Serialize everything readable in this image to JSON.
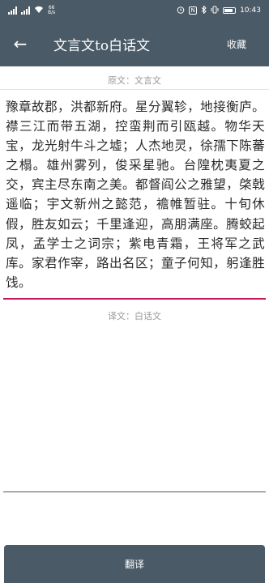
{
  "status_bar": {
    "net_speed_value": "66",
    "net_speed_unit": "B/s",
    "time": "10:43",
    "nfc_label": "N",
    "battery_percent": 70
  },
  "app_bar": {
    "title": "文言文to白话文",
    "back_glyph": "←",
    "collect_label": "收藏"
  },
  "source_section": {
    "label": "原文：文言文",
    "text": "豫章故郡，洪都新府。星分翼轸，地接衡庐。襟三江而带五湖，控蛮荆而引瓯越。物华天宝，龙光射牛斗之墟；人杰地灵，徐孺下陈蕃之榻。雄州雾列，俊采星驰。台隍枕夷夏之交，宾主尽东南之美。都督阎公之雅望，棨戟遥临；宇文新州之懿范，襜帷暂驻。十旬休假，胜友如云；千里逢迎，高朋满座。腾蛟起凤，孟学士之词宗；紫电青霜，王将军之武库。家君作宰，路出名区；童子何知，躬逢胜饯。"
  },
  "target_section": {
    "label": "译文：白话文",
    "text": ""
  },
  "translate_button": {
    "label": "翻译"
  }
}
